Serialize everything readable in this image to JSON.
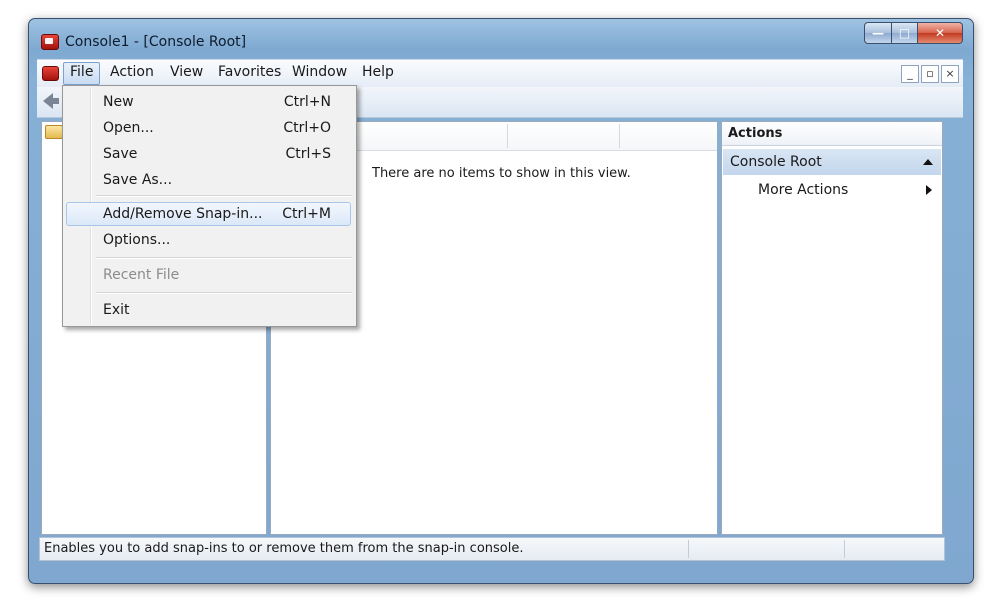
{
  "window": {
    "title": "Console1 - [Console Root]"
  },
  "menubar": {
    "items": [
      "File",
      "Action",
      "View",
      "Favorites",
      "Window",
      "Help"
    ],
    "mdi_buttons": [
      "_",
      "▫",
      "×"
    ]
  },
  "file_menu": {
    "items": [
      {
        "label": "New",
        "shortcut": "Ctrl+N"
      },
      {
        "label": "Open...",
        "shortcut": "Ctrl+O"
      },
      {
        "label": "Save",
        "shortcut": "Ctrl+S"
      },
      {
        "label": "Save As...",
        "shortcut": ""
      },
      {
        "label": "Add/Remove Snap-in...",
        "shortcut": "Ctrl+M"
      },
      {
        "label": "Options...",
        "shortcut": ""
      },
      {
        "label": "Recent File",
        "shortcut": ""
      },
      {
        "label": "Exit",
        "shortcut": ""
      }
    ]
  },
  "center": {
    "empty_message": "There are no items to show in this view."
  },
  "actions": {
    "title": "Actions",
    "section": "Console Root",
    "more": "More Actions"
  },
  "statusbar": {
    "text": "Enables you to add snap-ins to or remove them from the snap-in console."
  },
  "colors": {
    "frame": "#86b0d6",
    "menu_highlight": "#dbe8f8",
    "actions_header": "#c3d6ec"
  }
}
